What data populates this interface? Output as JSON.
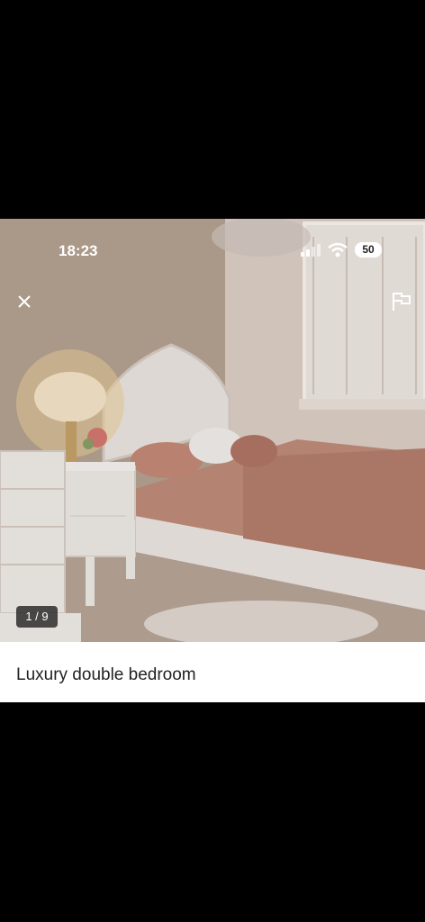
{
  "status_bar": {
    "time": "18:23",
    "battery": "50"
  },
  "photo": {
    "counter": "1 / 9",
    "description_icon": "bedroom-photo"
  },
  "listing": {
    "title": "Luxury double bedroom"
  },
  "icons": {
    "close": "close-icon",
    "report": "flag-icon"
  }
}
